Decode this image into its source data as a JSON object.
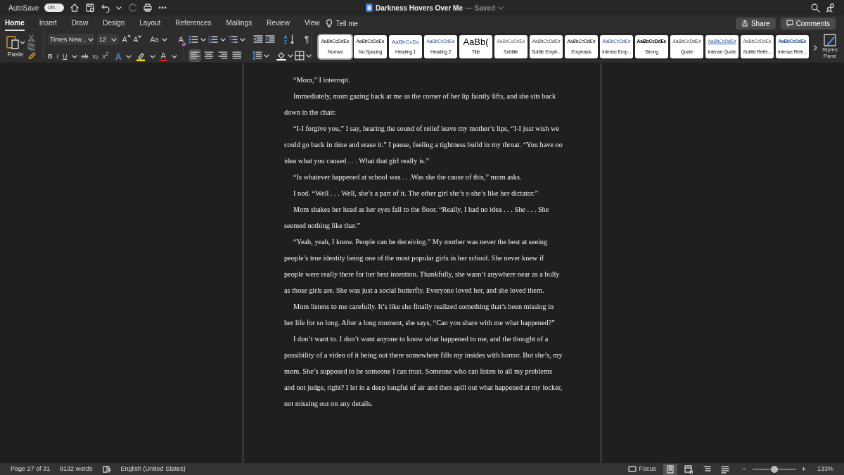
{
  "title_bar": {
    "autosave_label": "AutoSave",
    "autosave_toggle": {
      "label": "ON",
      "on": true
    },
    "document_title": "Darkness Hovers Over Me",
    "save_status": "— Saved"
  },
  "tabs": [
    {
      "label": "Home",
      "selected": true
    },
    {
      "label": "Insert",
      "selected": false
    },
    {
      "label": "Draw",
      "selected": false
    },
    {
      "label": "Design",
      "selected": false
    },
    {
      "label": "Layout",
      "selected": false
    },
    {
      "label": "References",
      "selected": false
    },
    {
      "label": "Mailings",
      "selected": false
    },
    {
      "label": "Review",
      "selected": false
    },
    {
      "label": "View",
      "selected": false
    }
  ],
  "tell_me": "Tell me",
  "share": "Share",
  "comments": "Comments",
  "ribbon": {
    "paste_label": "Paste",
    "font_name": "Times New...",
    "font_size": "12",
    "grow_font": "A",
    "shrink_font": "A",
    "change_case": "Aa",
    "clear_formatting": "A",
    "format_buttons": [
      {
        "kind": "bold",
        "label": "B"
      },
      {
        "kind": "italic",
        "label": "I"
      },
      {
        "kind": "underline",
        "label": "U"
      },
      {
        "kind": "strike",
        "label": "ab"
      },
      {
        "kind": "sub",
        "label": "x$_{2}$"
      },
      {
        "kind": "sup",
        "label": "x$^{2}$"
      }
    ],
    "text_effects": "A",
    "font_color": "A",
    "sort": "A Z",
    "pilcrow": "¶",
    "alignment": [
      {
        "kind": "left",
        "selected": true
      },
      {
        "kind": "center",
        "selected": false
      },
      {
        "kind": "right",
        "selected": false
      },
      {
        "kind": "justify",
        "selected": false
      }
    ],
    "styles": [
      {
        "label": "Normal",
        "preview": "AaBbCcDdEe",
        "kind": "normal",
        "selected": true
      },
      {
        "label": "No Spacing",
        "preview": "AaBbCcDdEe",
        "kind": "normal",
        "selected": false
      },
      {
        "label": "Heading 1",
        "preview": "AaBbCcDc",
        "kind": "heading1",
        "selected": false
      },
      {
        "label": "Heading 2",
        "preview": "AaBbCcDdEe",
        "kind": "heading2",
        "selected": false
      },
      {
        "label": "Title",
        "preview": "AaBb(",
        "kind": "title",
        "selected": false
      },
      {
        "label": "Subtitle",
        "preview": "AaBbCcDdEe",
        "kind": "subtitle",
        "selected": false
      },
      {
        "label": "Subtle Emph...",
        "preview": "AaBbCcDdEe",
        "kind": "subtle",
        "selected": false
      },
      {
        "label": "Emphasis",
        "preview": "AaBbCcDdEe",
        "kind": "emphasis",
        "selected": false
      },
      {
        "label": "Intense Emp...",
        "preview": "AaBbCcDdEe",
        "kind": "intense",
        "selected": false
      },
      {
        "label": "Strong",
        "preview": "AaBbCcDdEe",
        "kind": "strong",
        "selected": false
      },
      {
        "label": "Quote",
        "preview": "AaBbCcDdEe",
        "kind": "subtle",
        "selected": false
      },
      {
        "label": "Intense Quote",
        "preview": "AaBbCcDdEe",
        "kind": "intensequote",
        "selected": false
      },
      {
        "label": "Subtle Refer...",
        "preview": "AaBbCcDdEe",
        "kind": "subtleref",
        "selected": false
      },
      {
        "label": "Intense Refe...",
        "preview": "AaBbCcDdEe",
        "kind": "intenseref",
        "selected": false
      }
    ],
    "styles_pane": "Styles Pane"
  },
  "document": {
    "paragraphs": [
      "“Mom,” I interrupt.",
      "Immediately, mom gazing back at me as the corner of her lip faintly lifts, and she sits back down in the chair.",
      "“I-I forgive you,” I say, hearing the sound of relief leave my mother’s lips, “I-I just wish we could go back in time and erase it.” I pause, feeling a tightness build in my throat. “You have no idea what you caused . . . What that girl really is.”",
      "“Is whatever happened at school was . . .Was she the cause of this,” mom asks.",
      "I nod. “Well . . . Well, she’s a part of it. The other girl she’s s-she’s like her dictator.”",
      "Mom shakes her head as her eyes fall to the floor. “Really, I had no idea . . . She . . . She seemed nothing like that.”",
      "“Yeah, yeah, I know. People can be deceiving.” My mother was never the best at seeing people’s true identity being one of the most popular girls in her school. She never knew if people were really there for her best intention. Thankfully, she wasn’t anywhere near as a bully as those girls are. She was just a social butterfly. Everyone loved her, and she loved them.",
      "Mom listens to me carefully. It’s like she finally realized something that’s been missing in her life for so long. After a long moment, she says, “Can you share with me what happened?”",
      "I don’t want to. I don’t want anyone to know what happened to me, and the thought of a possibility of a video of it being out there somewhere fills my insides with horror. But she’s, my mom. She’s supposed to be someone I can trust. Someone who can listen to all my problems and not judge, right? I let in a deep lungful of air and then spill out what happened at my locker, not missing out on any details."
    ]
  },
  "status_bar": {
    "page": "Page 27 of 31",
    "words": "8132 words",
    "language": "English (United States)",
    "focus": "Focus",
    "views": [
      {
        "kind": "print",
        "selected": true
      },
      {
        "kind": "web",
        "selected": false
      },
      {
        "kind": "outline",
        "selected": false
      },
      {
        "kind": "draft",
        "selected": false
      }
    ],
    "zoom_out": "−",
    "zoom_in": "+",
    "zoom_slider": {
      "level": 0.5
    },
    "zoom": "133%"
  }
}
